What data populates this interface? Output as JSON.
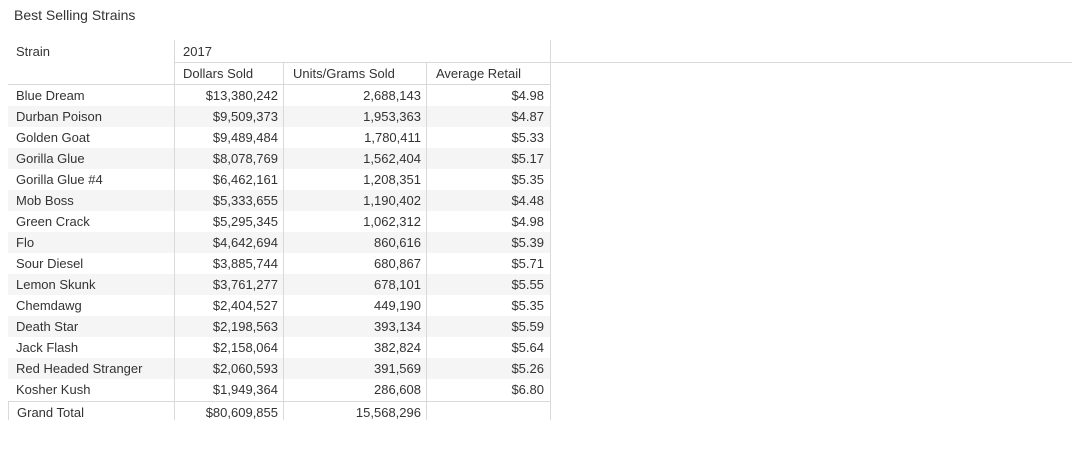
{
  "title": "Best Selling Strains",
  "chart_data": {
    "type": "table",
    "row_header": "Strain",
    "column_group": "2017",
    "columns": [
      "Dollars Sold",
      "Units/Grams Sold",
      "Average Retail"
    ],
    "rows": [
      {
        "strain": "Blue Dream",
        "dollars": "$13,380,242",
        "units": "2,688,143",
        "avg": "$4.98"
      },
      {
        "strain": "Durban Poison",
        "dollars": "$9,509,373",
        "units": "1,953,363",
        "avg": "$4.87"
      },
      {
        "strain": "Golden Goat",
        "dollars": "$9,489,484",
        "units": "1,780,411",
        "avg": "$5.33"
      },
      {
        "strain": "Gorilla Glue",
        "dollars": "$8,078,769",
        "units": "1,562,404",
        "avg": "$5.17"
      },
      {
        "strain": "Gorilla Glue #4",
        "dollars": "$6,462,161",
        "units": "1,208,351",
        "avg": "$5.35"
      },
      {
        "strain": "Mob Boss",
        "dollars": "$5,333,655",
        "units": "1,190,402",
        "avg": "$4.48"
      },
      {
        "strain": "Green Crack",
        "dollars": "$5,295,345",
        "units": "1,062,312",
        "avg": "$4.98"
      },
      {
        "strain": "Flo",
        "dollars": "$4,642,694",
        "units": "860,616",
        "avg": "$5.39"
      },
      {
        "strain": "Sour Diesel",
        "dollars": "$3,885,744",
        "units": "680,867",
        "avg": "$5.71"
      },
      {
        "strain": "Lemon Skunk",
        "dollars": "$3,761,277",
        "units": "678,101",
        "avg": "$5.55"
      },
      {
        "strain": "Chemdawg",
        "dollars": "$2,404,527",
        "units": "449,190",
        "avg": "$5.35"
      },
      {
        "strain": "Death Star",
        "dollars": "$2,198,563",
        "units": "393,134",
        "avg": "$5.59"
      },
      {
        "strain": "Jack Flash",
        "dollars": "$2,158,064",
        "units": "382,824",
        "avg": "$5.64"
      },
      {
        "strain": "Red Headed Stranger",
        "dollars": "$2,060,593",
        "units": "391,569",
        "avg": "$5.26"
      },
      {
        "strain": "Kosher Kush",
        "dollars": "$1,949,364",
        "units": "286,608",
        "avg": "$6.80"
      }
    ],
    "grand_total": {
      "label": "Grand Total",
      "dollars": "$80,609,855",
      "units": "15,568,296",
      "avg": ""
    }
  }
}
